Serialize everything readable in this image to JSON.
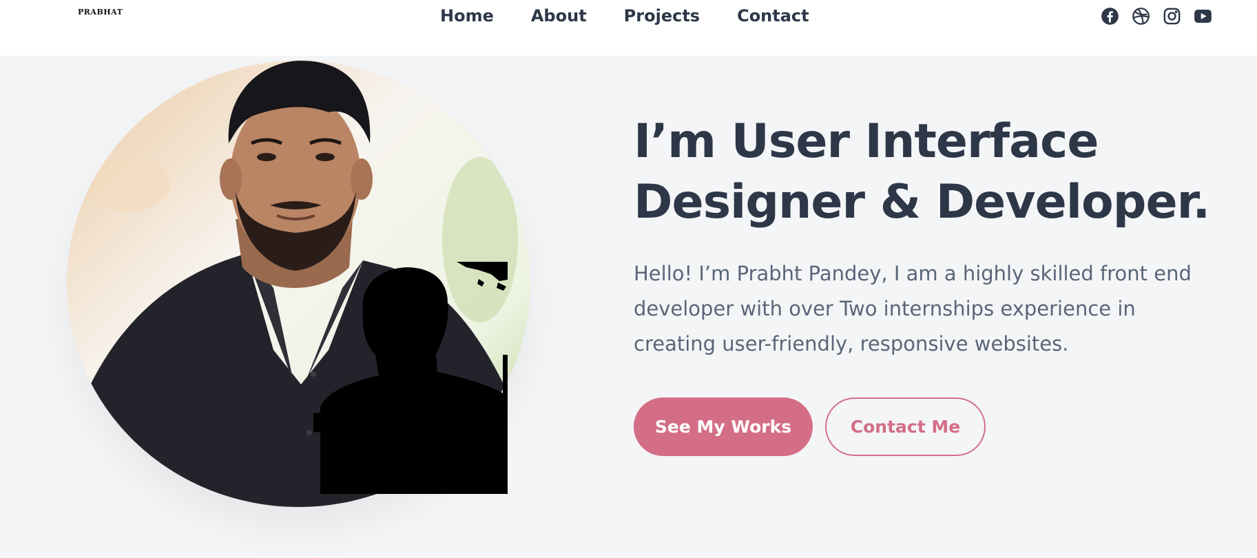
{
  "brand": {
    "logo_text": "PRABHAT"
  },
  "nav": {
    "items": [
      {
        "label": "Home"
      },
      {
        "label": "About"
      },
      {
        "label": "Projects"
      },
      {
        "label": "Contact"
      }
    ]
  },
  "social": {
    "icons": [
      "facebook-icon",
      "dribbble-icon",
      "instagram-icon",
      "youtube-icon"
    ]
  },
  "hero": {
    "headline": "I’m User Interface Designer & Developer.",
    "intro": "Hello! I’m Prabht Pandey, I am a highly skilled front end developer with over Two internships experience in creating user-friendly, responsive websites.",
    "primary_button": "See My Works",
    "secondary_button": "Contact Me"
  },
  "colors": {
    "accent": "#d46e87",
    "text_dark": "#2d3748",
    "text_muted": "#5a6578",
    "background": "#f4f5f7",
    "header_bg": "#ffffff"
  }
}
